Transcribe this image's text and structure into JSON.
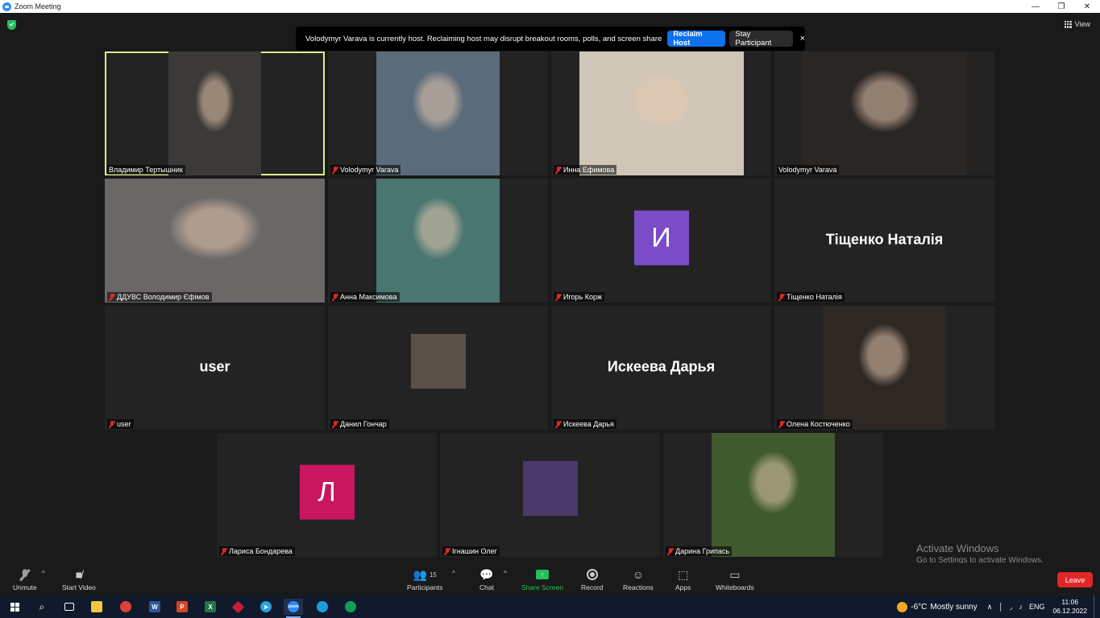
{
  "window": {
    "title": "Zoom Meeting",
    "controls": [
      "—",
      "❐",
      "✕"
    ]
  },
  "view_label": "View",
  "banner": {
    "message": "Volodymyr Varava is currently host. Reclaiming host may disrupt breakout rooms, polls, and screen share",
    "reclaim_label": "Reclaim Host",
    "stay_label": "Stay Participant",
    "close": "×"
  },
  "tiles": [
    {
      "name": "Владимир Тертышник",
      "muted": false,
      "kind": "video",
      "photo_color": "#3b3a36"
    },
    {
      "name": "Volodymyr Varava",
      "muted": true,
      "kind": "video",
      "photo_color": "#5a6b7a"
    },
    {
      "name": "Инна Ефимова",
      "muted": true,
      "kind": "video",
      "photo_color": "#cfc6b8"
    },
    {
      "name": "Volodymyr Varava",
      "muted": false,
      "kind": "video",
      "photo_color": "#2a2624"
    },
    {
      "name": "ДДУВС Володимир Єфімов",
      "muted": true,
      "kind": "video",
      "photo_color": "#6a6766"
    },
    {
      "name": "Анна Максимова",
      "muted": true,
      "kind": "video",
      "photo_color": "#4a7670"
    },
    {
      "name": "Игорь Корж",
      "muted": true,
      "kind": "avatar",
      "avatar_letter": "И",
      "avatar_color": "#7a4cc6"
    },
    {
      "name": "Тіщенко Наталія",
      "muted": true,
      "kind": "text",
      "display_text": "Тіщенко Наталія"
    },
    {
      "name": "user",
      "muted": true,
      "kind": "text",
      "display_text": "user"
    },
    {
      "name": "Данил Гончар",
      "muted": true,
      "kind": "thumb",
      "photo_color": "#5b5148"
    },
    {
      "name": "Искеева Дарья",
      "muted": true,
      "kind": "text",
      "display_text": "Искеева Дарья"
    },
    {
      "name": "Олена Костюченко",
      "muted": true,
      "kind": "video",
      "photo_color": "#2e2824"
    },
    {
      "name": "Лариса Бондарева",
      "muted": true,
      "kind": "avatar",
      "avatar_letter": "Л",
      "avatar_color": "#c8175e"
    },
    {
      "name": "Ігнашин Олег",
      "muted": true,
      "kind": "thumb",
      "photo_color": "#4a3a6a"
    },
    {
      "name": "Дарина Грипась",
      "muted": true,
      "kind": "video",
      "photo_color": "#3f5a2e"
    }
  ],
  "activate_windows": {
    "line1": "Activate Windows",
    "line2": "Go to Settings to activate Windows."
  },
  "toolbar": {
    "unmute": "Unmute",
    "start_video": "Start Video",
    "participants": "Participants",
    "participants_count": "15",
    "chat": "Chat",
    "share_screen": "Share Screen",
    "record": "Record",
    "reactions": "Reactions",
    "apps": "Apps",
    "whiteboards": "Whiteboards",
    "leave": "Leave"
  },
  "taskbar": {
    "weather_temp": "-6°C",
    "weather_text": "Mostly sunny",
    "lang": "ENG",
    "time": "11:06",
    "date": "06.12.2022"
  },
  "colors": {
    "accent_blue": "#0E72ED",
    "share_green": "#23c15b",
    "leave_red": "#e02828",
    "active_speaker": "#d9ef8a"
  }
}
